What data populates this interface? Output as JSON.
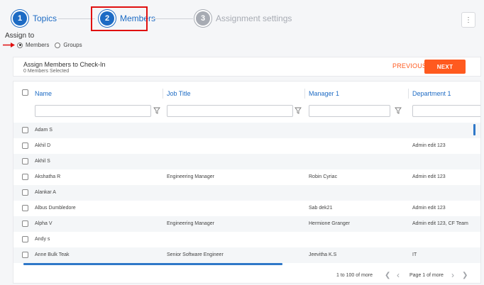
{
  "stepper": {
    "steps": [
      {
        "number": "1",
        "label": "Topics",
        "state": "done"
      },
      {
        "number": "2",
        "label": "Members",
        "state": "active"
      },
      {
        "number": "3",
        "label": "Assignment settings",
        "state": "pending"
      }
    ]
  },
  "more_menu": {
    "icon": "kebab-icon",
    "glyph": "⋮"
  },
  "assign_to": {
    "title": "Assign to",
    "options": [
      {
        "label": "Members",
        "selected": true
      },
      {
        "label": "Groups",
        "selected": false
      }
    ]
  },
  "header": {
    "title": "Assign Members to Check-In",
    "subtitle": "0 Members Selected",
    "previous_label": "PREVIOUS",
    "next_label": "NEXT"
  },
  "table": {
    "columns": [
      "Name",
      "Job Title",
      "Manager 1",
      "Department 1"
    ],
    "rows": [
      {
        "name": "Adam S",
        "job": "",
        "manager": "",
        "dept": ""
      },
      {
        "name": "Akhil D",
        "job": "",
        "manager": "",
        "dept": "Admin edit 123"
      },
      {
        "name": "Akhil S",
        "job": "",
        "manager": "",
        "dept": ""
      },
      {
        "name": "Akshatha R",
        "job": "Engineering Manager",
        "manager": "Robin Cyriac",
        "dept": "Admin edit 123"
      },
      {
        "name": "Alankar A",
        "job": "",
        "manager": "",
        "dept": ""
      },
      {
        "name": "Albus Dumbledore",
        "job": "",
        "manager": "Sab dek21",
        "dept": "Admin edit 123"
      },
      {
        "name": "Alpha V",
        "job": "Engineering Manager",
        "manager": "Hermione Granger",
        "dept": "Admin edit 123, CF Team"
      },
      {
        "name": "Andy s",
        "job": "",
        "manager": "",
        "dept": ""
      },
      {
        "name": "Anne Bulk Teak",
        "job": "Senior Software Engineer",
        "manager": "Jeevitha K.S",
        "dept": "IT"
      }
    ]
  },
  "pagination": {
    "range": "1 to 100 of more",
    "page": "Page 1 of more",
    "first": "❮",
    "prev": "‹",
    "next": "›",
    "last": "❯"
  },
  "colors": {
    "accent": "#1d6bc4",
    "cta": "#ff5a1f",
    "highlight": "#e01010"
  }
}
